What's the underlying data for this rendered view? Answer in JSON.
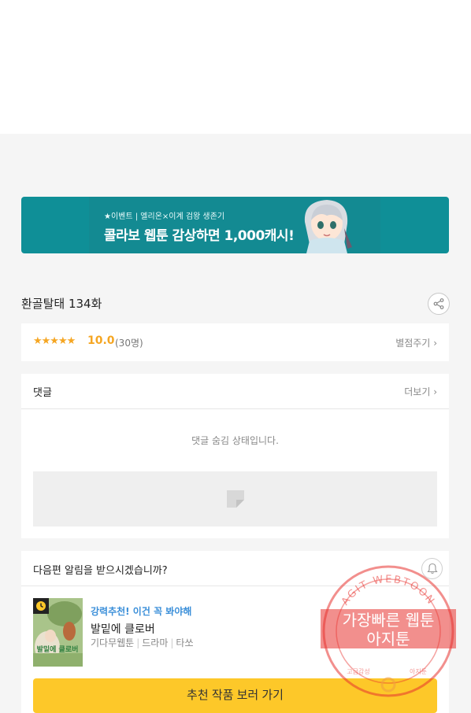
{
  "banner": {
    "subtitle": "★이벤트 | 엘리온×이계 검왕 생존기",
    "title": "콜라보 웹툰 감상하면 1,000캐시!"
  },
  "episode": {
    "title": "환골탈태 134화"
  },
  "rating": {
    "stars": "★★★★★",
    "score": "10.0",
    "count": "(30명)",
    "rate_link": "별점주기"
  },
  "comments": {
    "title": "댓글",
    "more": "더보기",
    "hidden_message": "댓글 숨김 상태입니다."
  },
  "notify": {
    "question": "다음편 알림을 받으시겠습니까?"
  },
  "recommend": {
    "tag": "강력추천! 이건 꼭 봐야해",
    "title": "발밑에 클로버",
    "meta": [
      "기다무웹툰",
      "드라마",
      "타쏘"
    ],
    "thumb_text": "발밑에 클로버",
    "button": "추천 작품 보러 가기"
  },
  "watermark": {
    "ring_text": "AGIT WEBTOON",
    "line1": "가장빠른 웹툰",
    "line2": "아지툰",
    "bottom_left": "고급감성",
    "bottom_right": "아지툰"
  },
  "colors": {
    "banner_bg": "#0f8f97",
    "accent_star": "#f5a623",
    "tag_blue": "#3b8fd9",
    "button_yellow": "#fdc829",
    "watermark_red": "#e8332f"
  }
}
